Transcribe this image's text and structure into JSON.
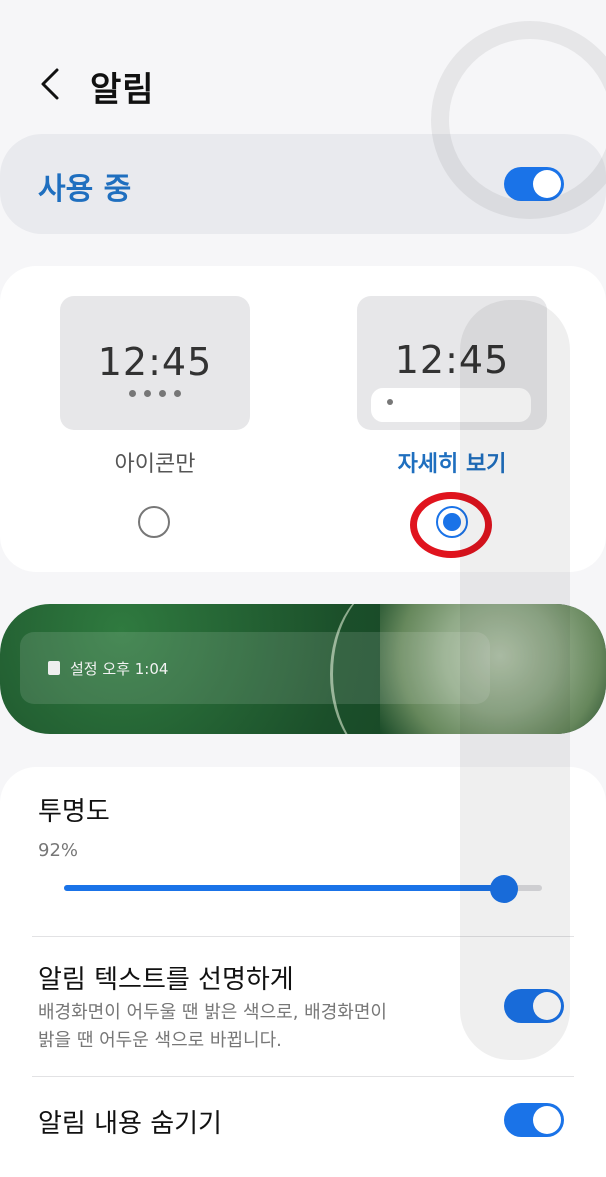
{
  "header": {
    "title": "알림"
  },
  "master": {
    "label": "사용 중",
    "enabled": true
  },
  "style_options": {
    "icon_only": {
      "clock": "12:45",
      "label": "아이콘만",
      "selected": false
    },
    "detailed": {
      "clock": "12:45",
      "label": "자세히 보기",
      "selected": true
    }
  },
  "lock_preview": {
    "text": "설정  오후 1:04"
  },
  "transparency": {
    "title": "투명도",
    "value_label": "92%",
    "value": 0.92
  },
  "clear_text": {
    "title": "알림 텍스트를 선명하게",
    "desc_line1": "배경화면이 어두울 땐 밝은 색으로, 배경화면이",
    "desc_line2": "밝을 땐 어두운 색으로 바뀝니다.",
    "enabled": true
  },
  "hide_content": {
    "title": "알림 내용 숨기기",
    "enabled": true
  },
  "colors": {
    "accent": "#1a73e8",
    "accent_text": "#1f6fbf",
    "highlight": "#e0141e"
  }
}
